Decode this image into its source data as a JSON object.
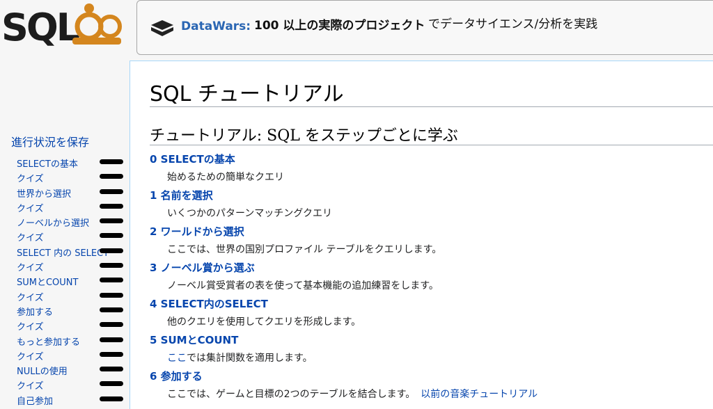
{
  "logo": {
    "text": "SQLZoo"
  },
  "banner": {
    "brand": "DataWars:",
    "highlight": "100 以上の実際のプロジェクト",
    "rest": "でデータサイエンス/分析を実践"
  },
  "sidebar": {
    "save_progress": "進行状況を保存",
    "items": [
      {
        "label": "SELECTの基本"
      },
      {
        "label": "クイズ"
      },
      {
        "label": "世界から選択"
      },
      {
        "label": "クイズ"
      },
      {
        "label": "ノーベルから選択"
      },
      {
        "label": "クイズ"
      },
      {
        "label": "SELECT 内の SELECT"
      },
      {
        "label": "クイズ"
      },
      {
        "label": "SUMとCOUNT"
      },
      {
        "label": "クイズ"
      },
      {
        "label": "参加する"
      },
      {
        "label": "クイズ"
      },
      {
        "label": "もっと参加する"
      },
      {
        "label": "クイズ"
      },
      {
        "label": "NULLの使用"
      },
      {
        "label": "クイズ"
      },
      {
        "label": "自己参加"
      }
    ]
  },
  "main": {
    "title": "SQL チュートリアル",
    "subtitle": "チュートリアル: SQL をステップごとに学ぶ",
    "lessons": [
      {
        "title": "0 SELECTの基本",
        "desc": "始めるための簡単なクエリ"
      },
      {
        "title": "1 名前を選択",
        "desc": "いくつかのパターンマッチングクエリ"
      },
      {
        "title": "2 ワールドから選択",
        "desc": "ここでは、世界の国別プロファイル テーブルをクエリします。"
      },
      {
        "title": "3 ノーベル賞から選ぶ",
        "desc": "ノーベル賞受賞者の表を使って基本機能の追加練習をします。"
      },
      {
        "title": "4 SELECT内のSELECT",
        "desc": "他のクエリを使用してクエリを形成します。"
      },
      {
        "title": "5 SUMとCOUNT",
        "desc_link": "ここ",
        "desc": "では集計関数を適用します。"
      },
      {
        "title": "6 参加する",
        "desc": "ここでは、ゲームと目標の2つのテーブルを結合します。",
        "desc_link_after": "以前の音楽チュートリアル"
      }
    ]
  }
}
